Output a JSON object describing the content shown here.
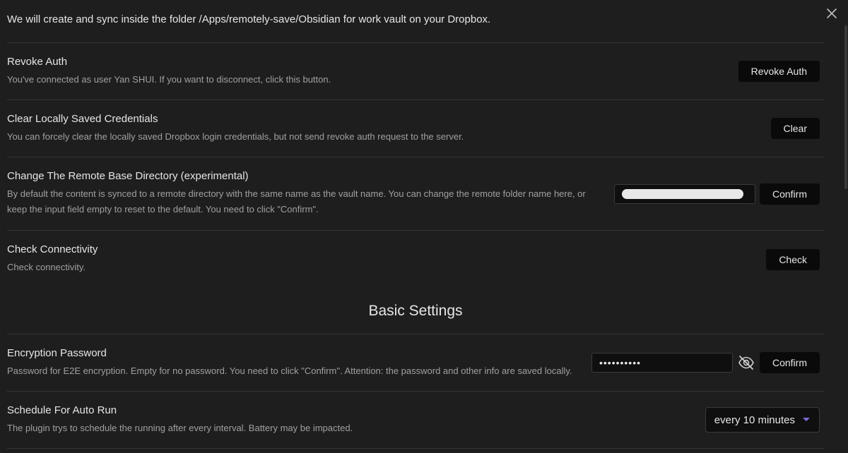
{
  "intro": {
    "text": "We will create and sync inside the folder /Apps/remotely-save/Obsidian for work vault on your Dropbox."
  },
  "revoke_auth": {
    "name": "Revoke Auth",
    "desc": "You've connected as user Yan SHUI. If you want to disconnect, click this button.",
    "button": "Revoke Auth"
  },
  "clear_credentials": {
    "name": "Clear Locally Saved Credentials",
    "desc": "You can forcely clear the locally saved Dropbox login credentials, but not send revoke auth request to the server.",
    "button": "Clear"
  },
  "remote_base_dir": {
    "name": "Change The Remote Base Directory (experimental)",
    "desc": "By default the content is synced to a remote directory with the same name as the vault name. You can change the remote folder name here, or keep the input field empty to reset to the default. You need to click \"Confirm\".",
    "button": "Confirm"
  },
  "check_connectivity": {
    "name": "Check Connectivity",
    "desc": "Check connectivity.",
    "button": "Check"
  },
  "basic_settings_heading": "Basic Settings",
  "encryption_password": {
    "name": "Encryption Password",
    "desc": "Password for E2E encryption. Empty for no password. You need to click \"Confirm\". Attention: the password and other info are saved locally.",
    "value": "••••••••••",
    "button": "Confirm",
    "toggle_icon": "eye-off-icon"
  },
  "schedule_auto_run": {
    "name": "Schedule For Auto Run",
    "desc": "The plugin trys to schedule the running after every interval. Battery may be impacted.",
    "selected": "every 10 minutes"
  },
  "colors": {
    "background": "#1e1e1e",
    "button": "#0a0a0a",
    "accent": "#7b6cd9",
    "divider": "#363636"
  }
}
